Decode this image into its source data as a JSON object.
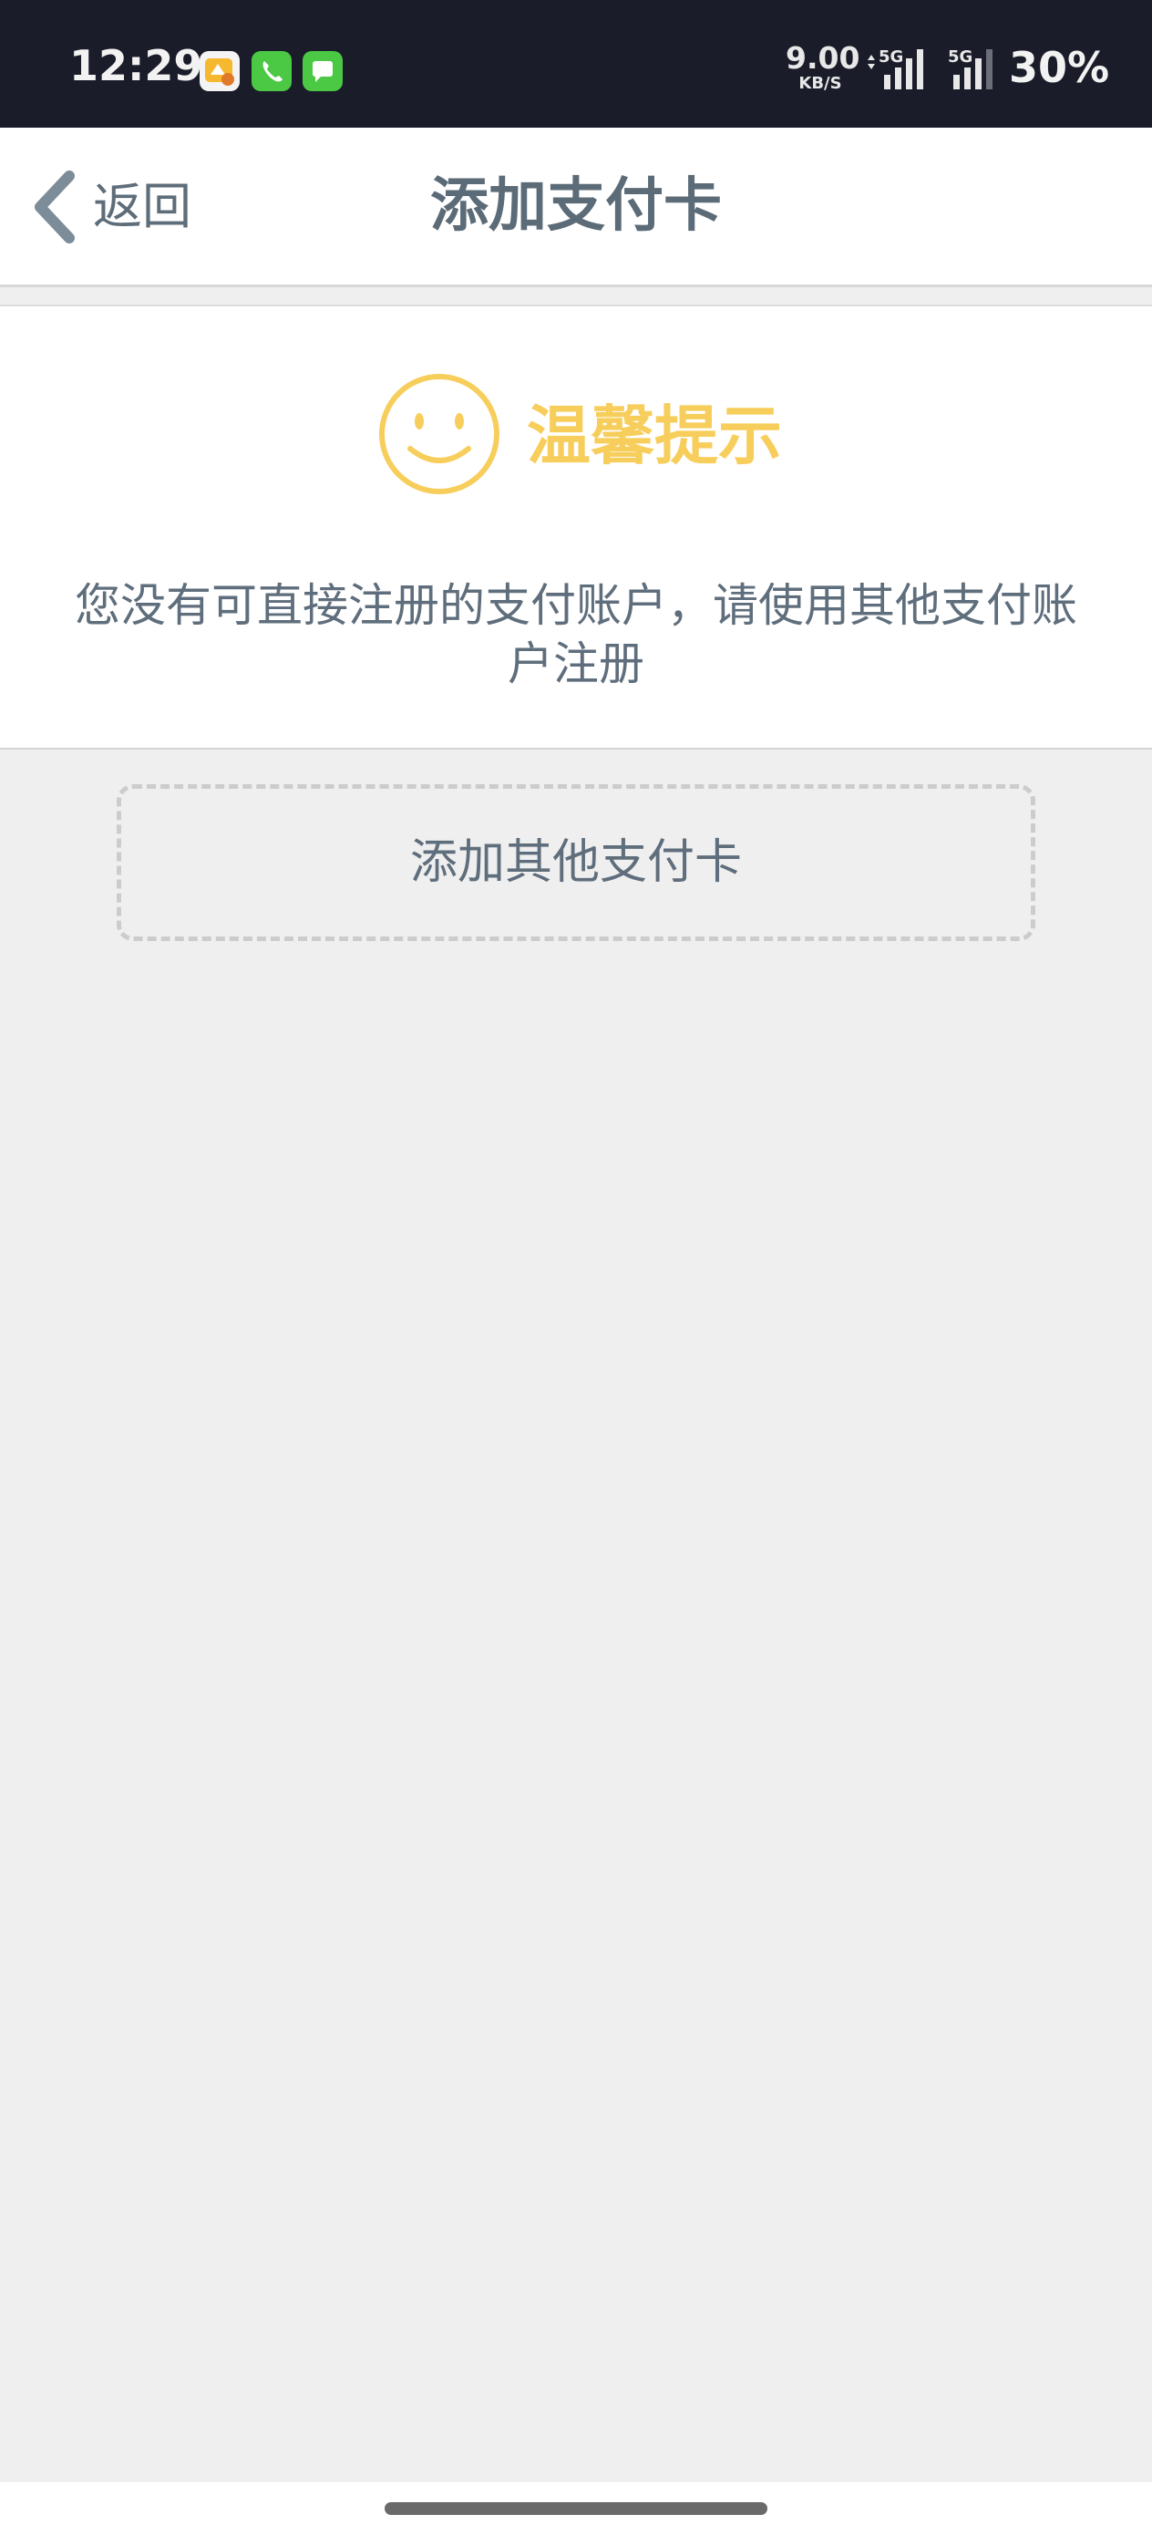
{
  "status_bar": {
    "time": "12:29",
    "net_speed_value": "9.00",
    "net_speed_unit": "KB/S",
    "sim1_label": "5G",
    "sim2_label": "5G",
    "battery": "30%",
    "notification_icons": [
      "photo-editor-icon",
      "phone-icon",
      "messages-icon"
    ]
  },
  "nav": {
    "back_label": "返回",
    "title": "添加支付卡"
  },
  "notice": {
    "icon": "smile-icon",
    "title": "温馨提示",
    "message": "您没有可直接注册的支付账户，请使用其他支付账户注册"
  },
  "actions": {
    "add_other_card": "添加其他支付卡"
  },
  "colors": {
    "status_bar_bg": "#1a1c29",
    "accent_yellow": "#f7ce5c",
    "text_gray": "#5f6e7c",
    "page_bg": "#efefef"
  }
}
